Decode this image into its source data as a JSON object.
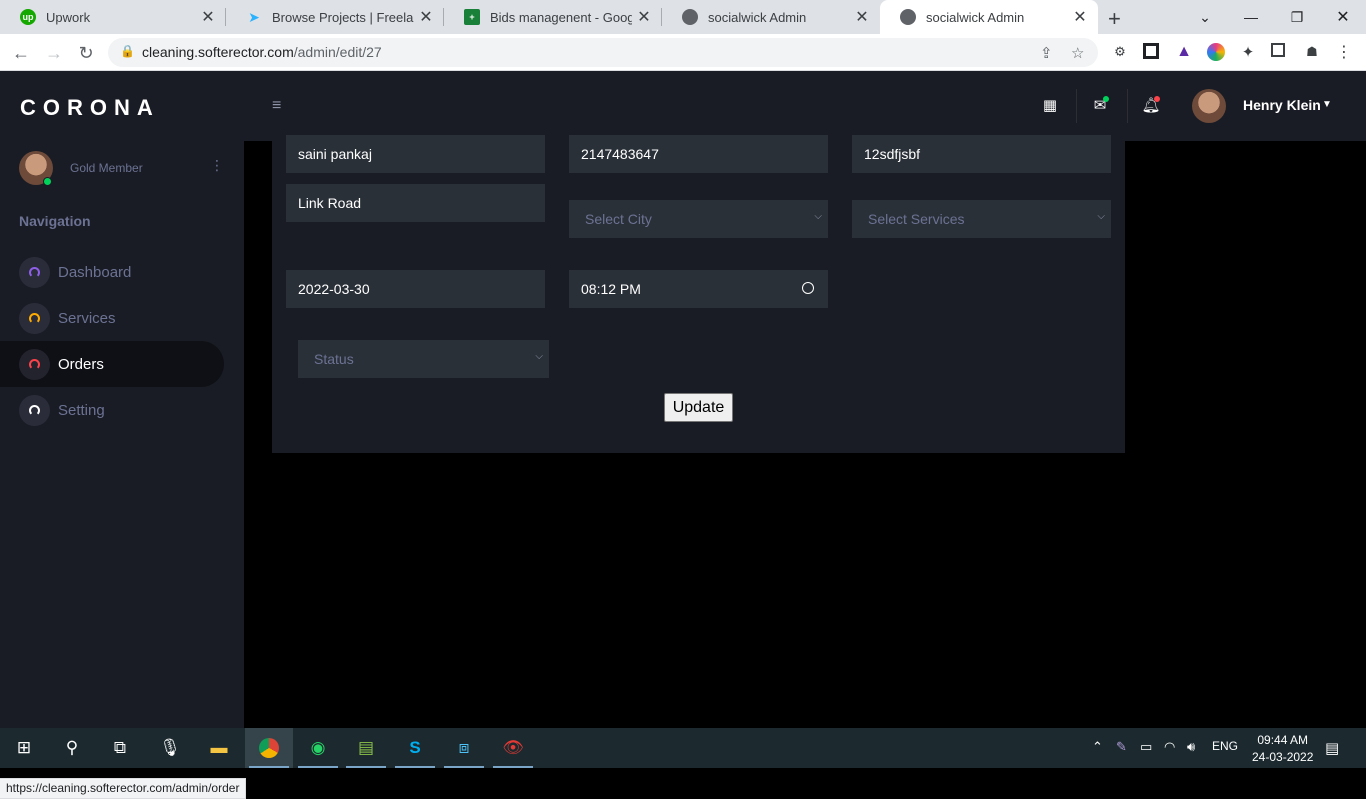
{
  "browser": {
    "tabs": [
      {
        "title": "Upwork",
        "fav": "up",
        "color": "#14a800"
      },
      {
        "title": "Browse Projects | Freelancer",
        "fav": "",
        "color": "#29b2fe"
      },
      {
        "title": "Bids managenent - Google Sheets",
        "fav": "+",
        "color": "#188038"
      },
      {
        "title": "socialwick Admin",
        "fav": "",
        "color": "#5f6368"
      },
      {
        "title": "socialwick Admin",
        "fav": "",
        "color": "#5f6368"
      }
    ],
    "url_host": "cleaning.softerector.com",
    "url_path": "/admin/edit/27",
    "status_url": "https://cleaning.softerector.com/admin/order"
  },
  "app": {
    "brand": "CORONA",
    "profile_role": "Gold Member",
    "nav_heading": "Navigation",
    "nav": [
      {
        "label": "Dashboard",
        "color": "#8f5fe8"
      },
      {
        "label": "Services",
        "color": "#ffab00"
      },
      {
        "label": "Orders",
        "color": "#fc424a"
      },
      {
        "label": "Setting",
        "color": "#ffffff"
      }
    ],
    "user_name": "Henry Klein"
  },
  "form": {
    "name": "saini pankaj",
    "phone": "2147483647",
    "code": "12sdfjsbf",
    "address": "Link Road",
    "city_placeholder": "Select City",
    "services_placeholder": "Select Services",
    "date": "2022-03-30",
    "time": "08:12 PM",
    "status_placeholder": "Status",
    "update_label": "Update"
  },
  "taskbar": {
    "lang": "ENG",
    "time": "09:44 AM",
    "date": "24-03-2022"
  }
}
